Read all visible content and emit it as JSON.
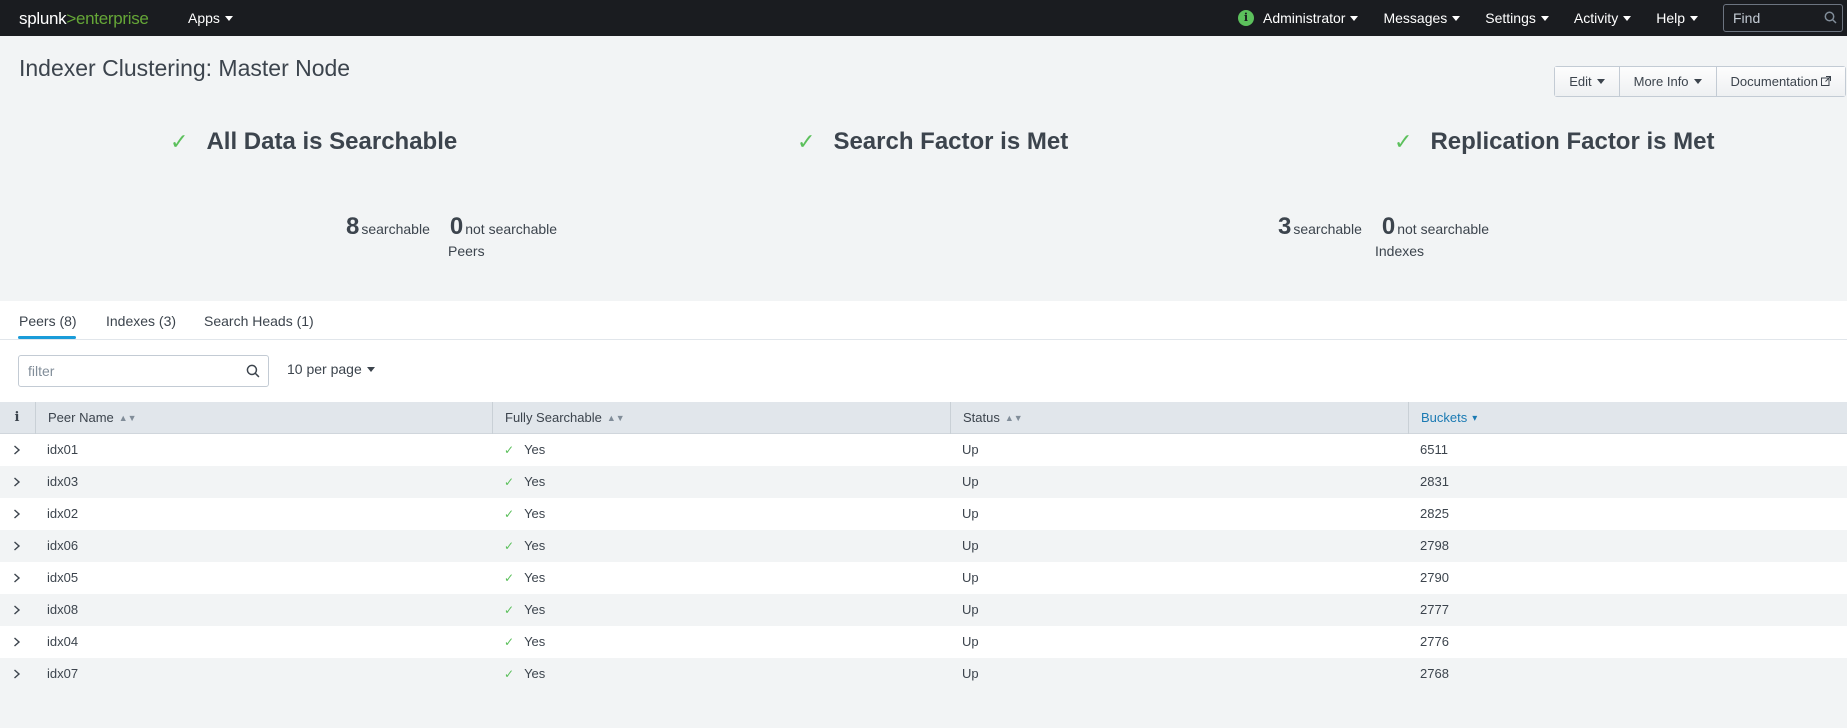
{
  "topbar": {
    "logo_splunk": "splunk",
    "logo_gt": ">",
    "logo_enterprise": "enterprise",
    "apps": "Apps",
    "info_icon": "i",
    "nav": [
      "Administrator",
      "Messages",
      "Settings",
      "Activity",
      "Help"
    ],
    "find_placeholder": "Find"
  },
  "header": {
    "title": "Indexer Clustering: Master Node",
    "buttons": {
      "edit": "Edit",
      "more_info": "More Info",
      "documentation": "Documentation"
    }
  },
  "status": {
    "data_searchable": "All Data is Searchable",
    "search_factor": "Search Factor is Met",
    "replication_factor": "Replication Factor is Met"
  },
  "stats": {
    "peers": {
      "searchable_count": "8",
      "searchable_label": "searchable",
      "not_count": "0",
      "not_label": "not searchable",
      "caption": "Peers"
    },
    "indexes": {
      "searchable_count": "3",
      "searchable_label": "searchable",
      "not_count": "0",
      "not_label": "not searchable",
      "caption": "Indexes"
    }
  },
  "tabs": [
    "Peers (8)",
    "Indexes (3)",
    "Search Heads (1)"
  ],
  "controls": {
    "filter_placeholder": "filter",
    "per_page": "10 per page"
  },
  "table": {
    "info_col": "i",
    "columns": [
      "Peer Name",
      "Fully Searchable",
      "Status",
      "Buckets"
    ],
    "sorted_column": "Buckets",
    "rows": [
      {
        "name": "idx01",
        "fully_searchable": "Yes",
        "status": "Up",
        "buckets": "6511"
      },
      {
        "name": "idx03",
        "fully_searchable": "Yes",
        "status": "Up",
        "buckets": "2831"
      },
      {
        "name": "idx02",
        "fully_searchable": "Yes",
        "status": "Up",
        "buckets": "2825"
      },
      {
        "name": "idx06",
        "fully_searchable": "Yes",
        "status": "Up",
        "buckets": "2798"
      },
      {
        "name": "idx05",
        "fully_searchable": "Yes",
        "status": "Up",
        "buckets": "2790"
      },
      {
        "name": "idx08",
        "fully_searchable": "Yes",
        "status": "Up",
        "buckets": "2777"
      },
      {
        "name": "idx04",
        "fully_searchable": "Yes",
        "status": "Up",
        "buckets": "2776"
      },
      {
        "name": "idx07",
        "fully_searchable": "Yes",
        "status": "Up",
        "buckets": "2768"
      }
    ]
  },
  "colors": {
    "accent": "#1a9cd9",
    "success": "#5cc05c",
    "topbar": "#1a1c20"
  }
}
